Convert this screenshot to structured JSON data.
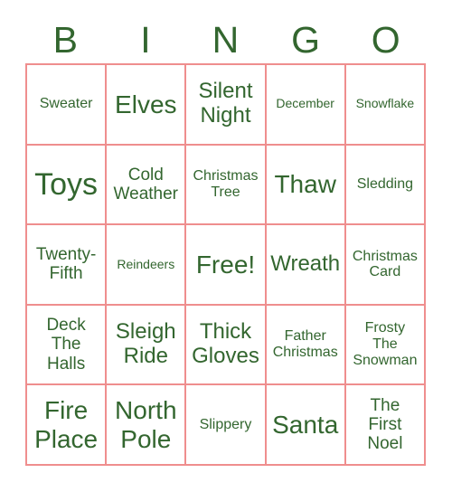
{
  "card": {
    "title": "BINGO",
    "colors": {
      "text_green": "#33662f",
      "grid_border_pink": "#ef8e8e",
      "background": "#ffffff"
    },
    "header": {
      "letters": [
        "B",
        "I",
        "N",
        "G",
        "O"
      ]
    },
    "free_space_label": "Free!",
    "grid": {
      "rows": 5,
      "columns": 5,
      "cells": [
        [
          {
            "text": "Sweater",
            "size": "sm"
          },
          {
            "text": "Elves",
            "size": "xl"
          },
          {
            "text": "Silent\nNight",
            "size": "lg"
          },
          {
            "text": "December",
            "size": "xs"
          },
          {
            "text": "Snowflake",
            "size": "xs"
          }
        ],
        [
          {
            "text": "Toys",
            "size": "xxl"
          },
          {
            "text": "Cold\nWeather",
            "size": "md"
          },
          {
            "text": "Christmas\nTree",
            "size": "sm"
          },
          {
            "text": "Thaw",
            "size": "xl"
          },
          {
            "text": "Sledding",
            "size": "sm"
          }
        ],
        [
          {
            "text": "Twenty-\nFifth",
            "size": "md"
          },
          {
            "text": "Reindeers",
            "size": "xs"
          },
          {
            "text": "Free!",
            "size": "xl"
          },
          {
            "text": "Wreath",
            "size": "lg"
          },
          {
            "text": "Christmas\nCard",
            "size": "sm"
          }
        ],
        [
          {
            "text": "Deck\nThe\nHalls",
            "size": "md"
          },
          {
            "text": "Sleigh\nRide",
            "size": "lg"
          },
          {
            "text": "Thick\nGloves",
            "size": "lg"
          },
          {
            "text": "Father\nChristmas",
            "size": "sm"
          },
          {
            "text": "Frosty\nThe\nSnowman",
            "size": "sm"
          }
        ],
        [
          {
            "text": "Fire\nPlace",
            "size": "xl"
          },
          {
            "text": "North\nPole",
            "size": "xl"
          },
          {
            "text": "Slippery",
            "size": "sm"
          },
          {
            "text": "Santa",
            "size": "xl"
          },
          {
            "text": "The\nFirst\nNoel",
            "size": "md"
          }
        ]
      ]
    }
  }
}
